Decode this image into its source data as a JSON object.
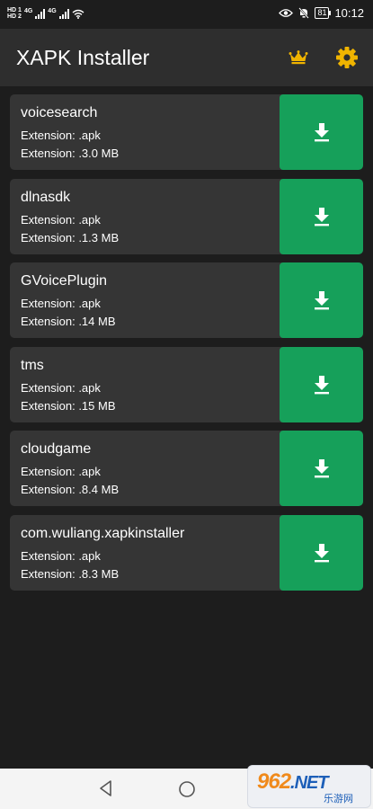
{
  "status_bar": {
    "hd1": "HD 1",
    "hd2": "HD 2",
    "net1": "4G",
    "net2": "4G",
    "battery": "81",
    "time": "10:12"
  },
  "app": {
    "title": "XAPK Installer",
    "crown_icon": "crown-icon",
    "settings_icon": "gear-icon",
    "accent": "#16a05a",
    "crown_color": "#f0b400"
  },
  "files": [
    {
      "name": "voicesearch",
      "extension": "Extension: .apk",
      "size": "Extension: .3.0 MB"
    },
    {
      "name": "dlnasdk",
      "extension": "Extension: .apk",
      "size": "Extension: .1.3 MB"
    },
    {
      "name": "GVoicePlugin",
      "extension": "Extension: .apk",
      "size": "Extension: .14 MB"
    },
    {
      "name": "tms",
      "extension": "Extension: .apk",
      "size": "Extension: .15 MB"
    },
    {
      "name": "cloudgame",
      "extension": "Extension: .apk",
      "size": "Extension: .8.4 MB"
    },
    {
      "name": "com.wuliang.xapkinstaller",
      "extension": "Extension: .apk",
      "size": "Extension: .8.3 MB"
    }
  ],
  "watermark": {
    "logo": "962",
    "net": ".NET",
    "subtitle": "乐游网"
  }
}
